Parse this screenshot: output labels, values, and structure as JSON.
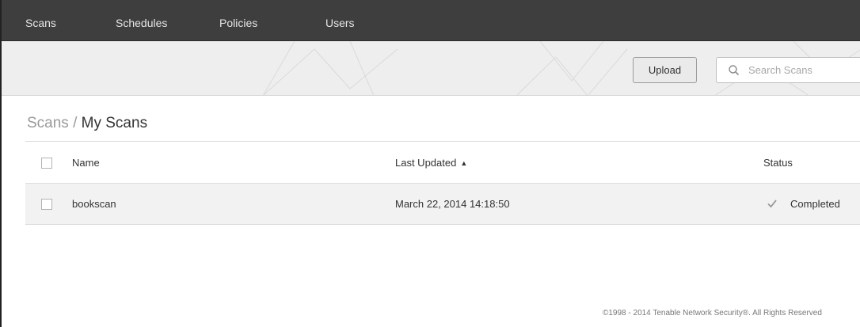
{
  "nav": {
    "items": [
      {
        "label": "Scans"
      },
      {
        "label": "Schedules"
      },
      {
        "label": "Policies"
      },
      {
        "label": "Users"
      }
    ]
  },
  "toolbar": {
    "upload_label": "Upload",
    "search_placeholder": "Search Scans"
  },
  "breadcrumb": {
    "parent": "Scans",
    "separator": " / ",
    "current": "My Scans"
  },
  "table": {
    "columns": [
      "Name",
      "Last Updated",
      "Status"
    ],
    "sort_indicator": "▲",
    "rows": [
      {
        "name": "bookscan",
        "last_updated": "March 22, 2014 14:18:50",
        "status": "Completed",
        "status_icon": "check-icon"
      }
    ]
  },
  "footer": {
    "copyright": "©1998 - 2014 Tenable Network Security®. All Rights Reserved"
  },
  "colors": {
    "nav_background": "#3e3e3e",
    "toolbar_background": "#eeeeee",
    "row_background": "#f2f2f2"
  }
}
